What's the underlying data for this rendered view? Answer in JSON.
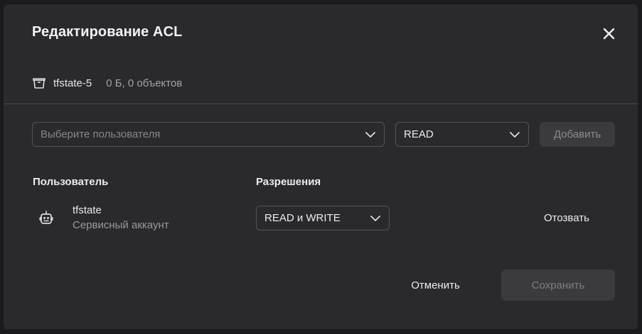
{
  "dialog": {
    "title": "Редактирование ACL",
    "close_icon": "close-icon"
  },
  "bucket": {
    "icon": "bucket-icon",
    "name": "tfstate-5",
    "meta": "0 Б, 0 объектов"
  },
  "add_form": {
    "user_placeholder": "Выберите пользователя",
    "permission_value": "READ",
    "add_label": "Добавить"
  },
  "table": {
    "headers": {
      "user": "Пользователь",
      "permissions": "Разрешения"
    },
    "rows": [
      {
        "icon": "robot-icon",
        "name": "tfstate",
        "type": "Сервисный аккаунт",
        "permission": "READ и WRITE",
        "revoke_label": "Отозвать"
      }
    ]
  },
  "footer": {
    "cancel_label": "Отменить",
    "save_label": "Сохранить"
  }
}
